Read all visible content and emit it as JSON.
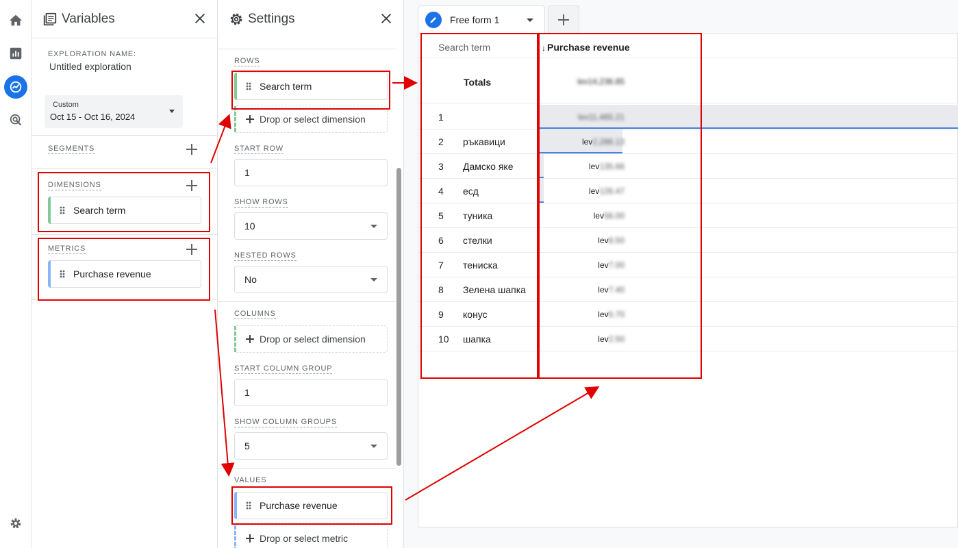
{
  "nav": {
    "items": [
      "home-icon",
      "reports-icon",
      "explore-icon",
      "advertising-icon"
    ],
    "bottom": "settings-icon"
  },
  "variables": {
    "title": "Variables",
    "exploration_name_label": "EXPLORATION NAME:",
    "exploration_name": "Untitled exploration",
    "date_label": "Custom",
    "date_range": "Oct 15 - Oct 16, 2024",
    "segments_label": "SEGMENTS",
    "dimensions_label": "DIMENSIONS",
    "dimension_item": "Search term",
    "metrics_label": "METRICS",
    "metric_item": "Purchase revenue"
  },
  "settings": {
    "title": "Settings",
    "rows_label": "ROWS",
    "rows_item": "Search term",
    "rows_drop": "Drop or select dimension",
    "start_row_label": "START ROW",
    "start_row": "1",
    "show_rows_label": "SHOW ROWS",
    "show_rows": "10",
    "nested_rows_label": "NESTED ROWS",
    "nested_rows": "No",
    "columns_label": "COLUMNS",
    "columns_drop": "Drop or select dimension",
    "start_col_group_label": "START COLUMN GROUP",
    "start_col_group": "1",
    "show_col_groups_label": "SHOW COLUMN GROUPS",
    "show_col_groups": "5",
    "values_label": "VALUES",
    "values_item": "Purchase revenue",
    "values_drop": "Drop or select metric"
  },
  "tabs": {
    "active": "Free form 1"
  },
  "table": {
    "dim_header": "Search term",
    "metric_header": "Purchase revenue",
    "sort_arrow": "↓",
    "totals_label": "Totals",
    "totals_value": "lev14,236.85",
    "rows": [
      {
        "n": "1",
        "term": "",
        "prefix": "",
        "value": "lev11,465.21"
      },
      {
        "n": "2",
        "term": "ръкавици",
        "prefix": "lev",
        "value": "2,286.13"
      },
      {
        "n": "3",
        "term": "Дамско яке",
        "prefix": "lev",
        "value": "135.66"
      },
      {
        "n": "4",
        "term": "есд",
        "prefix": "lev",
        "value": "126.47"
      },
      {
        "n": "5",
        "term": "туника",
        "prefix": "lev",
        "value": "56.00"
      },
      {
        "n": "6",
        "term": "стелки",
        "prefix": "lev",
        "value": "8.50"
      },
      {
        "n": "7",
        "term": "тениска",
        "prefix": "lev",
        "value": "7.00"
      },
      {
        "n": "8",
        "term": "Зелена шапка",
        "prefix": "lev",
        "value": "7.40"
      },
      {
        "n": "9",
        "term": "конус",
        "prefix": "lev",
        "value": "6.70"
      },
      {
        "n": "10",
        "term": "шапка",
        "prefix": "lev",
        "value": "2.50"
      }
    ]
  },
  "colors": {
    "accent": "#1a73e8",
    "dimension_bar": "#81c995",
    "metric_bar": "#8ab4f8",
    "annotation": "#e00000"
  }
}
